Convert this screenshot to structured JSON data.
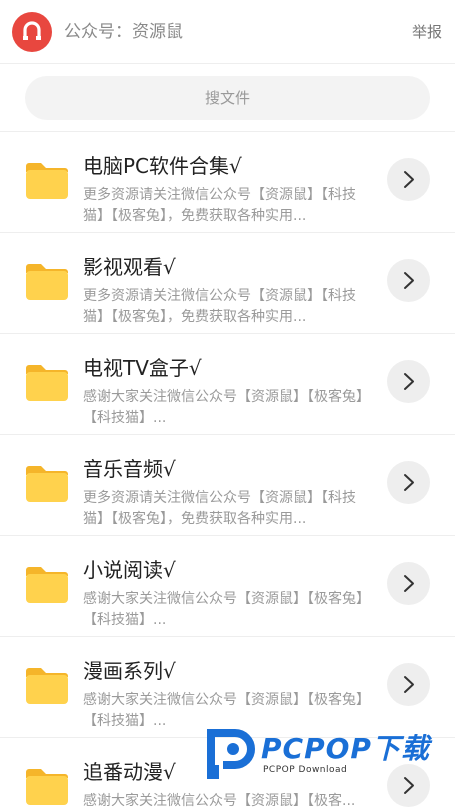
{
  "header": {
    "account_label": "公众号：资源鼠",
    "report_label": "举报",
    "brand_color": "#e8473f"
  },
  "search": {
    "placeholder": "搜文件"
  },
  "folders": [
    {
      "title": "电脑PC软件合集√",
      "desc": "更多资源请关注微信公众号【资源鼠】【科技猫】【极客兔】，免费获取各种实用..."
    },
    {
      "title": "影视观看√",
      "desc": "更多资源请关注微信公众号【资源鼠】【科技猫】【极客兔】，免费获取各种实用..."
    },
    {
      "title": "电视TV盒子√",
      "desc": "感谢大家关注微信公众号【资源鼠】【极客兔】【科技猫】..."
    },
    {
      "title": "音乐音频√",
      "desc": "更多资源请关注微信公众号【资源鼠】【科技猫】【极客兔】，免费获取各种实用..."
    },
    {
      "title": "小说阅读√",
      "desc": "感谢大家关注微信公众号【资源鼠】【极客兔】【科技猫】..."
    },
    {
      "title": "漫画系列√",
      "desc": "感谢大家关注微信公众号【资源鼠】【极客兔】【科技猫】..."
    },
    {
      "title": "追番动漫√",
      "desc": "感谢大家关注微信公众号【资源鼠】【极客..."
    }
  ],
  "icons": {
    "folder": "folder-icon",
    "arrow": "chevron-right-icon",
    "logo": "magnet-icon",
    "folder_color": "#ffd24d"
  },
  "watermark": {
    "text": "PCPOP下载",
    "subtext": "PCPOP Download",
    "color": "#1a6fd6"
  }
}
